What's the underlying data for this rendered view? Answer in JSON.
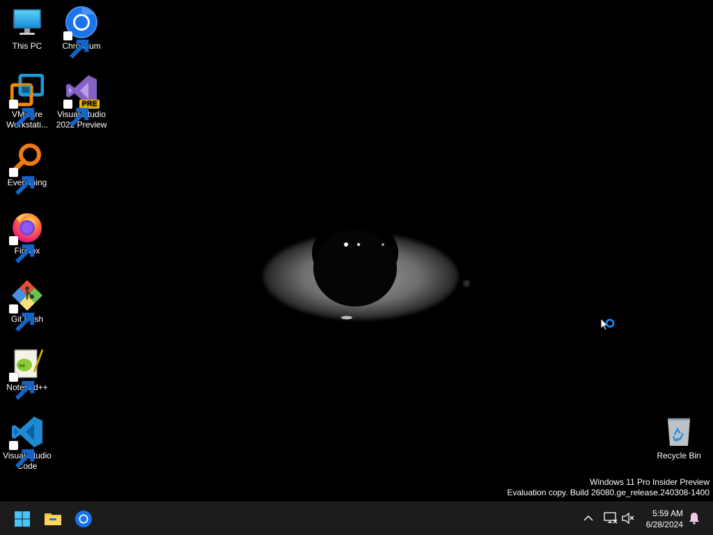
{
  "desktop": {
    "icons": [
      {
        "label_line1": "This PC",
        "label_line2": "",
        "icon": "this-pc-icon",
        "shortcut": false
      },
      {
        "label_line1": "Chromium",
        "label_line2": "",
        "icon": "chromium-icon",
        "shortcut": true
      },
      {
        "label_line1": "VMware",
        "label_line2": "Workstati...",
        "icon": "vmware-icon",
        "shortcut": true
      },
      {
        "label_line1": "Visual Studio",
        "label_line2": "2022 Preview",
        "icon": "visual-studio-icon",
        "shortcut": true,
        "badge": "PRE"
      },
      {
        "label_line1": "Everything",
        "label_line2": "",
        "icon": "everything-search-icon",
        "shortcut": true
      },
      {
        "label_line1": "Firefox",
        "label_line2": "",
        "icon": "firefox-icon",
        "shortcut": true
      },
      {
        "label_line1": "Git Bash",
        "label_line2": "",
        "icon": "git-bash-icon",
        "shortcut": true
      },
      {
        "label_line1": "Notepad++",
        "label_line2": "",
        "icon": "notepad-plus-plus-icon",
        "shortcut": true
      },
      {
        "label_line1": "Visual Studio",
        "label_line2": "Code",
        "icon": "vscode-icon",
        "shortcut": true
      },
      {
        "label_line1": "Recycle Bin",
        "label_line2": "",
        "icon": "recycle-bin-icon",
        "shortcut": false
      }
    ],
    "watermark": {
      "line1": "Windows 11 Pro Insider Preview",
      "line2": "Evaluation copy. Build 26080.ge_release.240308-1400"
    },
    "wallpaper": "eye-in-darkness"
  },
  "taskbar": {
    "pinned": [
      {
        "icon": "windows-start-icon",
        "label": "Start"
      },
      {
        "icon": "file-explorer-icon",
        "label": "File Explorer"
      },
      {
        "icon": "chromium-icon",
        "label": "Chromium"
      }
    ],
    "tray": {
      "icons": [
        "chevron-up-icon",
        "network-disconnected-icon",
        "volume-muted-icon"
      ],
      "time": "5:59 AM",
      "date": "6/28/2024",
      "notification_icon": "bell-icon"
    }
  },
  "colors": {
    "taskbar_bg": "#1c1c1c",
    "desktop_bg": "#000000",
    "accent": "#0078d4"
  }
}
